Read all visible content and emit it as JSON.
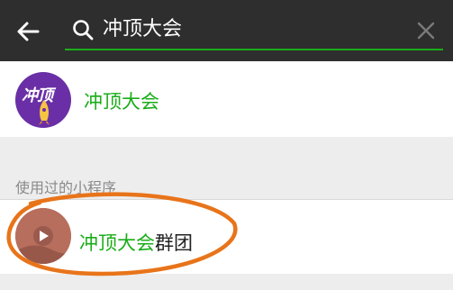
{
  "search": {
    "query": "冲顶大会"
  },
  "result": {
    "title": "冲顶大会",
    "avatar_text": "冲顶"
  },
  "section": {
    "label": "使用过的小程序"
  },
  "program": {
    "title_highlight": "冲顶大会",
    "title_rest": "群团"
  },
  "colors": {
    "topbar": "#2e2e2e",
    "accent": "#1aad19",
    "annotation": "#e8741a"
  }
}
